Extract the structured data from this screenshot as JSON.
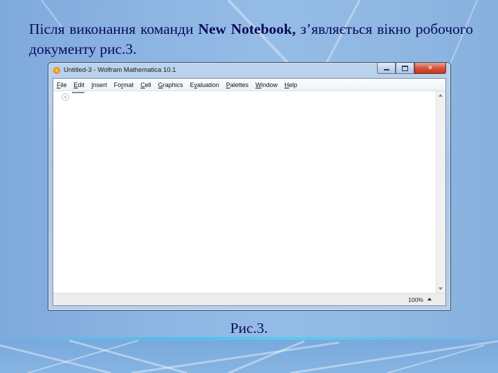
{
  "slide": {
    "text_before": "Після виконання команди ",
    "text_bold": "New Notebook,",
    "text_after": " з’являється вікно робочого документу рис.3.",
    "caption": "Рис.3."
  },
  "window": {
    "title": "Untitled-3 - Wolfram Mathematica 10.1",
    "controls": {
      "minimize": "minimize",
      "maximize": "maximize",
      "close": "✕"
    },
    "menu": [
      {
        "label": "File",
        "mnemonic": "F"
      },
      {
        "label": "Edit",
        "mnemonic": "E"
      },
      {
        "label": "Insert",
        "mnemonic": "I"
      },
      {
        "label": "Format",
        "mnemonic": "r"
      },
      {
        "label": "Cell",
        "mnemonic": "C"
      },
      {
        "label": "Graphics",
        "mnemonic": "G"
      },
      {
        "label": "Evaluation",
        "mnemonic": "v"
      },
      {
        "label": "Palettes",
        "mnemonic": "P"
      },
      {
        "label": "Window",
        "mnemonic": "W"
      },
      {
        "label": "Help",
        "mnemonic": "H"
      }
    ],
    "cell_insert_glyph": "+",
    "status": {
      "zoom": "100%"
    }
  }
}
